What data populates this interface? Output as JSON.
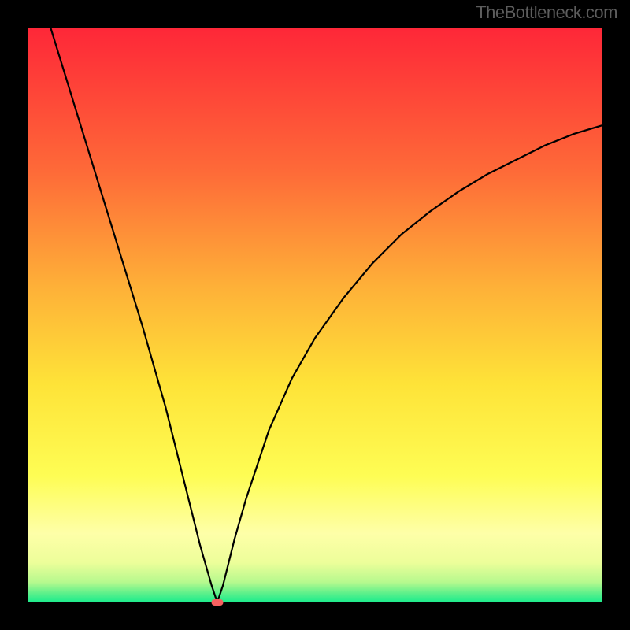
{
  "watermark": "TheBottleneck.com",
  "chart_data": {
    "type": "line",
    "title": "",
    "xlabel": "",
    "ylabel": "",
    "xlim": [
      0,
      100
    ],
    "ylim": [
      0,
      100
    ],
    "gradient_colors": {
      "top": "#fe2738",
      "upper_mid": "#fe8338",
      "mid": "#fed838",
      "lower_mid": "#feff77",
      "near_bottom": "#e2fd8e",
      "bottom": "#1bec8d"
    },
    "series": [
      {
        "name": "bottleneck-curve",
        "description": "V-shaped curve descending from top-left, reaching minimum near x=33, then rising with diminishing slope toward upper right",
        "x": [
          4,
          8,
          12,
          16,
          20,
          24,
          28,
          30,
          32,
          33,
          34,
          36,
          38,
          42,
          46,
          50,
          55,
          60,
          65,
          70,
          75,
          80,
          85,
          90,
          95,
          100
        ],
        "y": [
          100,
          87,
          74,
          61,
          48,
          34,
          18,
          10,
          3,
          0,
          3,
          11,
          18,
          30,
          39,
          46,
          53,
          59,
          64,
          68,
          71.5,
          74.5,
          77,
          79.5,
          81.5,
          83
        ]
      }
    ],
    "marker": {
      "x": 33,
      "y": 0,
      "color": "#f86060"
    }
  }
}
